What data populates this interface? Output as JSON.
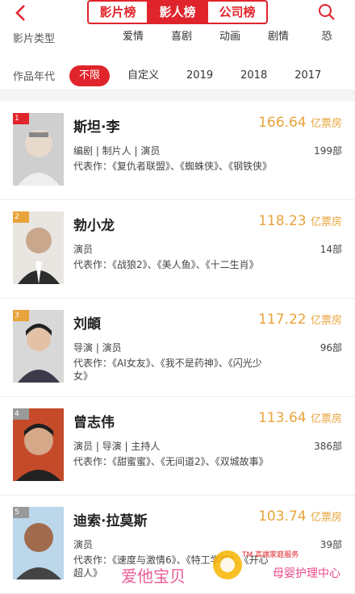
{
  "nav": {
    "back_icon": "chevron-left-icon",
    "tabs": [
      {
        "label": "影片榜"
      },
      {
        "label": "影人榜"
      },
      {
        "label": "公司榜"
      }
    ],
    "search_icon": "search-icon"
  },
  "filters": {
    "type_label": "影片类型",
    "types": [
      "不限",
      "爱情",
      "喜剧",
      "动画",
      "剧情",
      "恐"
    ],
    "year_label": "作品年代",
    "years": [
      "不限",
      "自定义",
      "2019",
      "2018",
      "2017"
    ]
  },
  "colors": {
    "accent": "#e0242b",
    "gold": "#e8a33b"
  },
  "people": [
    {
      "rank": "1",
      "name": "斯坦·李",
      "box": "166.64",
      "unit": "亿票房",
      "roles": "编剧 | 制片人 | 演员",
      "count": "199部",
      "works": "代表作：《复仇者联盟》、《蜘蛛侠》、《钢铁侠》"
    },
    {
      "rank": "2",
      "name": "勃小龙",
      "box": "118.23",
      "unit": "亿票房",
      "roles": "演员",
      "count": "14部",
      "works": "代表作：《战狼2》、《美人鱼》、《十二生肖》"
    },
    {
      "rank": "3",
      "name": "刘頔",
      "box": "117.22",
      "unit": "亿票房",
      "roles": "导演 | 演员",
      "count": "96部",
      "works": "代表作：《AI女友》、《我不是药神》、《闪光少女》"
    },
    {
      "rank": "4",
      "name": "曾志伟",
      "box": "113.64",
      "unit": "亿票房",
      "roles": "演员 | 导演 | 主持人",
      "count": "386部",
      "works": "代表作：《甜蜜蜜》、《无间道2》、《双城故事》"
    },
    {
      "rank": "5",
      "name": "迪索·拉莫斯",
      "box": "103.74",
      "unit": "亿票房",
      "roles": "演员",
      "count": "39部",
      "works": "代表作：《速度与激情6》、《特工学院》、《开心超人》"
    }
  ],
  "watermark": {
    "brand": "爱他宝贝",
    "tagline": "TM 高端家庭服务",
    "service": "母婴护理中心"
  }
}
